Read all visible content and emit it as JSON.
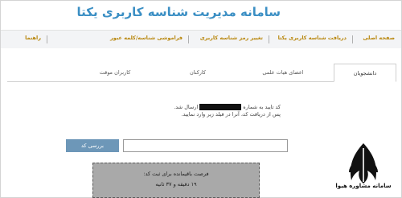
{
  "app_title": "سامانه مدیریت شناسه کاربری یکتا",
  "nav": {
    "items": [
      {
        "label": "صفحه اصلی"
      },
      {
        "label": "دریافت شناسه کاربری یکتا"
      },
      {
        "label": "تغییر رمز شناسه کاربری"
      },
      {
        "label": "فراموشی شناسه/کلمه عبور"
      },
      {
        "label": "راهنما"
      }
    ]
  },
  "tabs": [
    {
      "label": "دانشجویان",
      "active": true
    },
    {
      "label": "اعضای هیات علمی",
      "active": false
    },
    {
      "label": "کارکنان",
      "active": false
    },
    {
      "label": "کاربران موقت",
      "active": false
    }
  ],
  "message": {
    "line1_part1": "کد تایید به شماره",
    "line1_part2": "ارسال شد.",
    "line2": "پس از دریافت کد، آنرا در فیلد زیر وارد نمایید."
  },
  "form": {
    "code_value": "",
    "check_button_label": "بررسی کد"
  },
  "timer": {
    "line1": "فرصت باقیمانده برای ثبت کد:",
    "line2": "۱۹ دقیقه و ۳۷ ثانیه"
  },
  "logo": {
    "text": "سامانه مشاوره هیوا",
    "icon": "quill-pen-icon"
  }
}
